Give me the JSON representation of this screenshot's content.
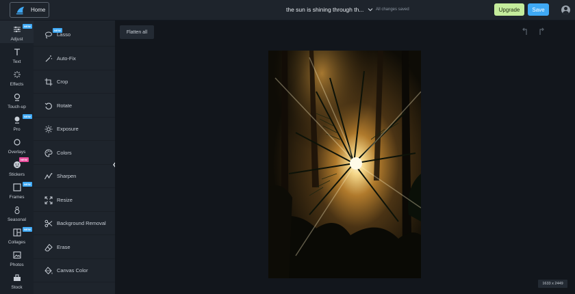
{
  "topbar": {
    "home_label": "Home",
    "doc_title": "the sun is shining through th...",
    "save_status": "All changes saved",
    "upgrade_label": "Upgrade",
    "save_label": "Save"
  },
  "rail": {
    "items": [
      {
        "label": "Adjust",
        "icon": "sliders-icon",
        "badge": "NEW",
        "active": true
      },
      {
        "label": "Text",
        "icon": "text-icon"
      },
      {
        "label": "Effects",
        "icon": "sparkle-icon"
      },
      {
        "label": "Touch-up",
        "icon": "face-icon"
      },
      {
        "label": "Pro",
        "icon": "crown-icon",
        "badge": "NEW"
      },
      {
        "label": "Overlays",
        "icon": "circle-icon"
      },
      {
        "label": "Stickers",
        "icon": "sticker-icon",
        "badge": "NEW",
        "badge_color": "pink"
      },
      {
        "label": "Frames",
        "icon": "frame-icon",
        "badge": "NEW"
      },
      {
        "label": "Seasonal",
        "icon": "snowman-icon"
      },
      {
        "label": "Collages",
        "icon": "collage-icon",
        "badge": "NEW"
      },
      {
        "label": "Photos",
        "icon": "photo-icon"
      },
      {
        "label": "Stock",
        "icon": "stock-icon"
      }
    ]
  },
  "tools": {
    "items": [
      {
        "label": "Lasso",
        "icon": "lasso-icon",
        "badge": "NEW"
      },
      {
        "label": "Auto-Fix",
        "icon": "magic-wand-icon"
      },
      {
        "label": "Crop",
        "icon": "crop-icon"
      },
      {
        "label": "Rotate",
        "icon": "rotate-icon"
      },
      {
        "label": "Exposure",
        "icon": "sun-icon"
      },
      {
        "label": "Colors",
        "icon": "palette-icon"
      },
      {
        "label": "Sharpen",
        "icon": "sharpen-icon"
      },
      {
        "label": "Resize",
        "icon": "resize-icon"
      },
      {
        "label": "Background Removal",
        "icon": "scissors-icon"
      },
      {
        "label": "Erase",
        "icon": "eraser-icon"
      },
      {
        "label": "Canvas Color",
        "icon": "paint-bucket-icon"
      }
    ]
  },
  "canvas": {
    "flatten_label": "Flatten all",
    "dimensions": "1633 x 2449"
  },
  "colors": {
    "accent": "#3fa9f5",
    "upgrade": "#c4ec9c",
    "badge_new": "#3fa9f5",
    "badge_pink": "#e94b9b"
  }
}
